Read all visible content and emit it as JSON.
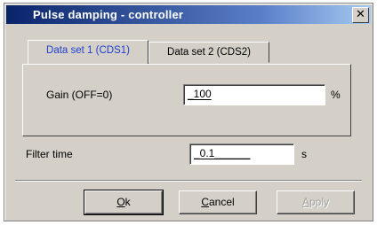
{
  "window": {
    "title": "Pulse damping - controller",
    "close_glyph": "✕"
  },
  "tabs": [
    {
      "label": "Data set 1 (CDS1)",
      "active": true
    },
    {
      "label": "Data set 2 (CDS2)",
      "active": false
    }
  ],
  "gain": {
    "label": "Gain (OFF=0)",
    "value": "_100",
    "unit": "%"
  },
  "filter": {
    "label": "Filter time",
    "value": "_0.1______",
    "unit": "s"
  },
  "buttons": {
    "ok": {
      "accel": "O",
      "rest": "k"
    },
    "cancel": {
      "accel": "C",
      "rest": "ancel"
    },
    "apply": {
      "accel": "A",
      "rest": "pply",
      "disabled": true
    }
  },
  "colors": {
    "titlebar_start": "#0a246a",
    "titlebar_end": "#a6caf0",
    "active_tab_text": "#1f3fd0"
  }
}
